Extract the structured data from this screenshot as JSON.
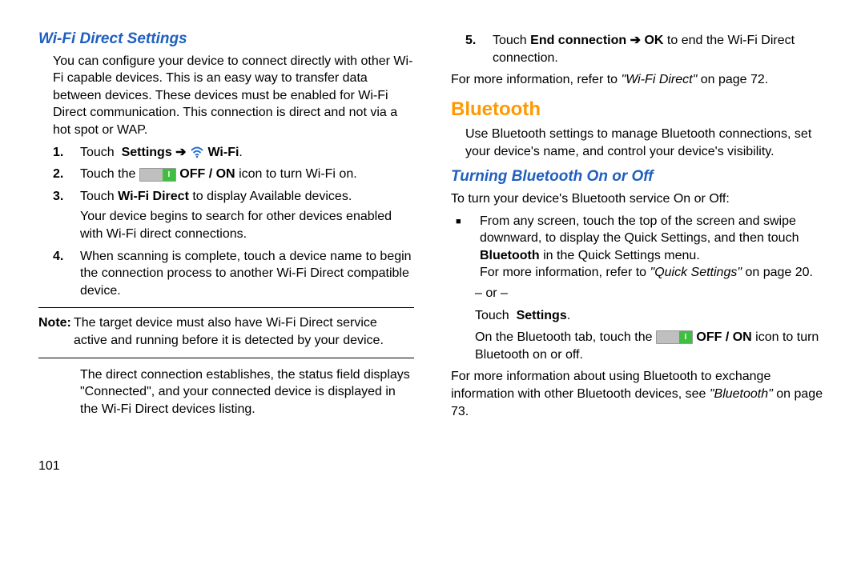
{
  "left": {
    "heading": "Wi-Fi Direct Settings",
    "intro": "You can configure your device to connect directly with other Wi-Fi capable devices. This is an easy way to transfer data between devices. These devices must be enabled for Wi-Fi Direct communication. This connection is direct and not via a hot spot or WAP.",
    "step1_a": "Touch ",
    "step1_b": " Settings ",
    "step1_c": " Wi-Fi",
    "step2_a": "Touch the ",
    "step2_b": " OFF / ON",
    "step2_c": " icon to turn Wi-Fi on.",
    "step3_a": "Touch ",
    "step3_b": "Wi-Fi Direct",
    "step3_c": " to display Available devices.",
    "step3_d": "Your device begins to search for other devices enabled with Wi-Fi direct connections.",
    "step4": "When scanning is complete, touch a device name to begin the connection process to another Wi-Fi Direct compatible device.",
    "note_label": "Note:",
    "note_text": "The target device must also have Wi-Fi Direct service active and running before it is detected by your device.",
    "after_note": "The direct connection establishes, the status field displays \"Connected\", and your connected device is displayed in the Wi-Fi Direct devices listing.",
    "page_num": "101",
    "nums": {
      "n1": "1.",
      "n2": "2.",
      "n3": "3.",
      "n4": "4."
    },
    "arrow": "➔"
  },
  "right": {
    "step5_num": "5.",
    "step5_a": "Touch ",
    "step5_b": "End connection",
    "step5_c": " OK",
    "step5_d": " to end the Wi-Fi Direct connection.",
    "more1_a": "For more information, refer to ",
    "more1_b": "\"Wi-Fi Direct\"",
    "more1_c": " on page 72.",
    "bt_heading": "Bluetooth",
    "bt_intro": "Use Bluetooth settings to manage Bluetooth connections, set your device's name, and control your device's visibility.",
    "sub_heading": "Turning Bluetooth On or Off",
    "sub_intro": "To turn your device's Bluetooth service On or Off:",
    "bul1_a": "From any screen, touch the top of the screen and swipe downward, to display the Quick Settings, and then touch ",
    "bul1_b": "Bluetooth",
    "bul1_c": " in the Quick Settings menu.",
    "bul1_more_a": "For more information, refer to ",
    "bul1_more_b": "\"Quick Settings\"",
    "bul1_more_c": " on page 20.",
    "or": "– or –",
    "touch_a": "Touch ",
    "touch_b": " Settings",
    "touch_c": ".",
    "bt_tab_a": "On the Bluetooth tab, touch the ",
    "bt_tab_b": " OFF / ON",
    "bt_tab_c": " icon to turn Bluetooth on or off.",
    "final_a": "For more information about using Bluetooth to exchange information with other Bluetooth devices, see ",
    "final_b": "\"Bluetooth\"",
    "final_c": " on page 73.",
    "arrow": "➔",
    "square": "■"
  }
}
